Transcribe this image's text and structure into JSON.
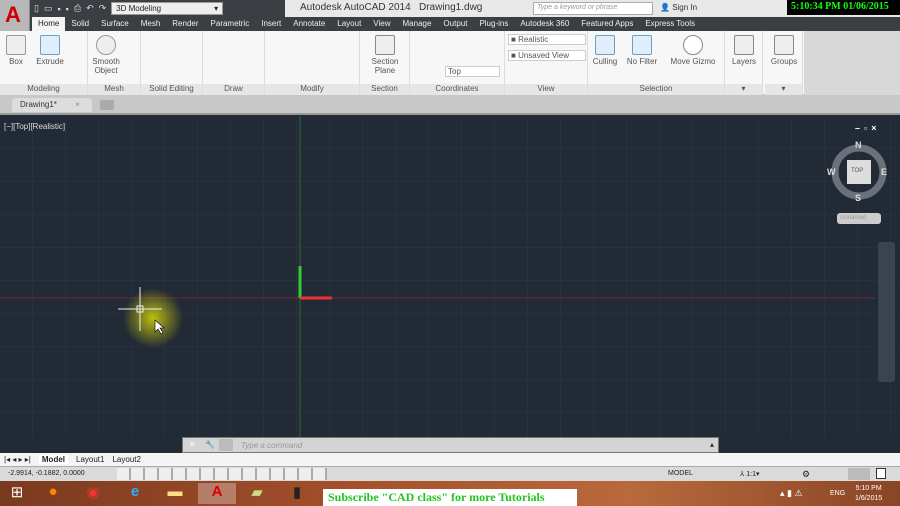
{
  "title_bar": {
    "app_title": "Autodesk AutoCAD 2014",
    "file_name": "Drawing1.dwg",
    "workspace": "3D Modeling",
    "search_placeholder": "Type a keyword or phrase",
    "sign_in": "Sign In",
    "overlay_clock": "5:10:34 PM 01/06/2015"
  },
  "ribbon_tabs": [
    "Home",
    "Solid",
    "Surface",
    "Mesh",
    "Render",
    "Parametric",
    "Insert",
    "Annotate",
    "Layout",
    "View",
    "Manage",
    "Output",
    "Plug-ins",
    "Autodesk 360",
    "Featured Apps",
    "Express Tools"
  ],
  "panels": {
    "modeling": "Modeling",
    "mesh": "Mesh",
    "solid_editing": "Solid Editing",
    "draw": "Draw",
    "modify": "Modify",
    "section": "Section",
    "coordinates": "Coordinates",
    "view": "View",
    "selection": "Selection"
  },
  "tools": {
    "box": "Box",
    "extrude": "Extrude",
    "smooth_object": "Smooth Object",
    "section_plane": "Section Plane",
    "visual_style": "Realistic",
    "named_view": "Unsaved View",
    "ucs_view": "Top",
    "culling": "Culling",
    "no_filter": "No Filter",
    "move_gizmo": "Move Gizmo",
    "layers": "Layers",
    "groups": "Groups"
  },
  "doc_tab": "Drawing1*",
  "viewport_label": "[−][Top][Realistic]",
  "viewcube": {
    "n": "N",
    "s": "S",
    "e": "E",
    "w": "W",
    "face": "TOP",
    "ucs": "Unnamed"
  },
  "command_placeholder": "Type a command",
  "layout_tabs": [
    "Model",
    "Layout1",
    "Layout2"
  ],
  "status": {
    "coords": "-2.9914, -0.1882, 0.0000",
    "model": "MODEL",
    "scale": "1:1"
  },
  "taskbar": {
    "banner": "Subscribe \"CAD class\" for more Tutorials",
    "lang": "ENG",
    "time": "5:10 PM",
    "date": "1/6/2015"
  },
  "colors": {
    "accent": "#c00000",
    "canvas": "#222a35",
    "x_axis": "#e03030",
    "y_axis": "#30c030"
  }
}
